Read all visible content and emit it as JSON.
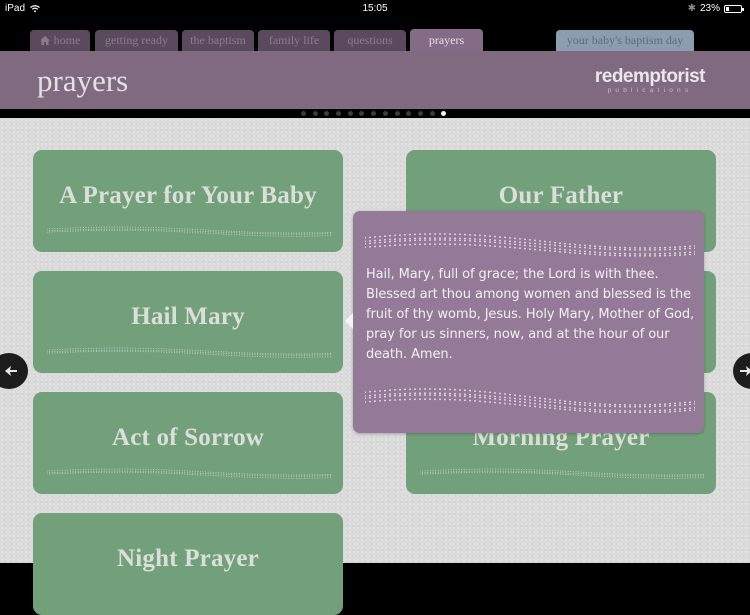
{
  "status_bar": {
    "device": "iPad",
    "time": "15:05",
    "battery": "23%",
    "battery_level": 0.23,
    "icons": [
      "wifi-icon",
      "bluetooth-icon",
      "battery-icon"
    ]
  },
  "tabs": [
    {
      "label": "home",
      "icon": "home-icon",
      "active": false
    },
    {
      "label": "getting ready",
      "active": false
    },
    {
      "label": "the baptism",
      "active": false
    },
    {
      "label": "family life",
      "active": false
    },
    {
      "label": "questions",
      "active": false
    },
    {
      "label": "prayers",
      "active": true
    }
  ],
  "special_tab": {
    "label": "your baby's baptism day"
  },
  "header": {
    "title": "prayers",
    "logo": {
      "name": "redemptorist",
      "sub": "publications"
    }
  },
  "page_indicator": {
    "total": 13,
    "current": 13
  },
  "prayers": [
    {
      "label": "A Prayer for Your Baby"
    },
    {
      "label": "Our Father"
    },
    {
      "label": "Hail Mary"
    },
    {
      "label": ""
    },
    {
      "label": "Act of Sorrow"
    },
    {
      "label": "Morning Prayer"
    },
    {
      "label": "Night Prayer"
    }
  ],
  "popover": {
    "for": "Hail Mary",
    "text": "Hail, Mary, full of grace; the Lord is with thee. Blessed art thou among women and blessed is the fruit of thy womb, Jesus. Holy Mary, Mother of God, pray for us sinners, now, and at the hour of our death. Amen."
  },
  "nav": {
    "prev_icon": "arrow-left-icon",
    "next_icon": "arrow-right-icon"
  },
  "colors": {
    "header_purple": "#7f6a80",
    "popover_purple": "#937a96",
    "card_green": "#72a07b",
    "special_tab_blue": "#8b9eb0",
    "background_gray": "#dadada"
  }
}
